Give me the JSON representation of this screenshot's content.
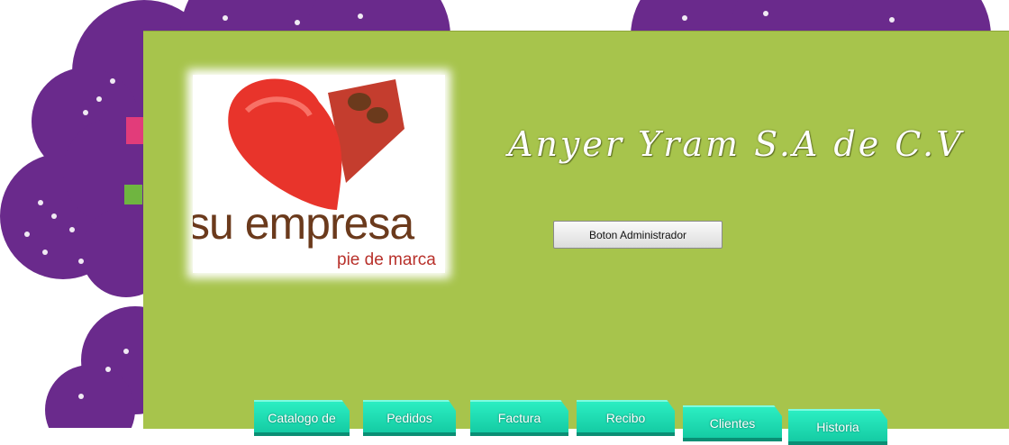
{
  "company_name": "Anyer Yram S.A de C.V",
  "logo": {
    "brand": "su empresa",
    "tagline": "pie de marca"
  },
  "admin_button_label": "Boton Administrador",
  "tabs": [
    {
      "label": "Catalogo de"
    },
    {
      "label": "Pedidos"
    },
    {
      "label": "Factura"
    },
    {
      "label": "Recibo"
    },
    {
      "label": "Clientes"
    },
    {
      "label": "Historia"
    }
  ],
  "colors": {
    "panel": "#a7c44c",
    "decoration": "#6a2a8c",
    "tab": "#2df0c4"
  }
}
